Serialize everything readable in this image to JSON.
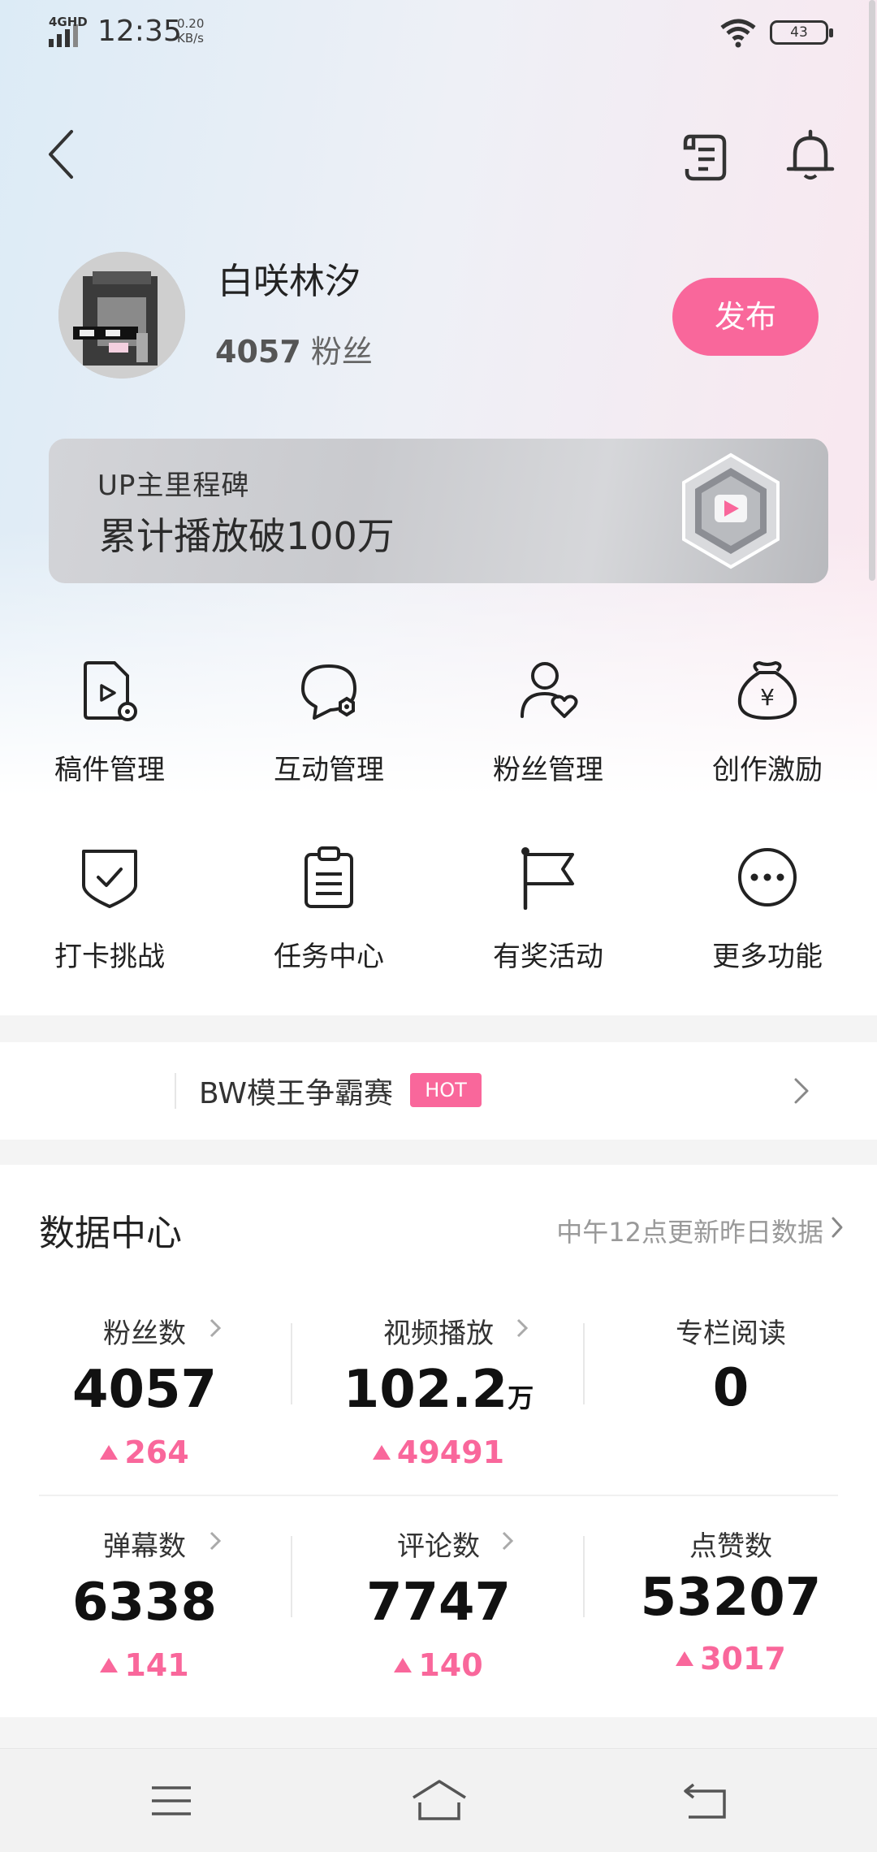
{
  "status_bar": {
    "network": "4GHD",
    "time": "12:35",
    "speed_value": "0.20",
    "speed_unit": "KB/s",
    "battery": "43"
  },
  "header": {
    "back_icon": "chevron-left-icon",
    "doc_icon": "receipt-icon",
    "bell_icon": "bell-icon"
  },
  "profile": {
    "name": "白咲林汐",
    "fans_count": "4057",
    "fans_label": "粉丝",
    "publish_label": "发布"
  },
  "milestone": {
    "title": "UP主里程碑",
    "text": "累计播放破100万"
  },
  "features": [
    {
      "label": "稿件管理",
      "icon": "file-play-icon"
    },
    {
      "label": "互动管理",
      "icon": "chat-bubble-icon"
    },
    {
      "label": "粉丝管理",
      "icon": "user-heart-icon"
    },
    {
      "label": "创作激励",
      "icon": "money-bag-icon"
    },
    {
      "label": "打卡挑战",
      "icon": "shield-check-icon"
    },
    {
      "label": "任务中心",
      "icon": "clipboard-icon"
    },
    {
      "label": "有奖活动",
      "icon": "flag-icon"
    },
    {
      "label": "更多功能",
      "icon": "more-dots-icon"
    }
  ],
  "banner": {
    "text": "BW模王争霸赛",
    "badge": "HOT"
  },
  "data_center": {
    "title": "数据中心",
    "note": "中午12点更新昨日数据",
    "stats": [
      {
        "label": "粉丝数",
        "value": "4057",
        "unit": "",
        "delta": "264",
        "has_arrow": true
      },
      {
        "label": "视频播放",
        "value": "102.2",
        "unit": "万",
        "delta": "49491",
        "has_arrow": true
      },
      {
        "label": "专栏阅读",
        "value": "0",
        "unit": "",
        "delta": "",
        "has_arrow": false
      },
      {
        "label": "弹幕数",
        "value": "6338",
        "unit": "",
        "delta": "141",
        "has_arrow": true
      },
      {
        "label": "评论数",
        "value": "7747",
        "unit": "",
        "delta": "140",
        "has_arrow": true
      },
      {
        "label": "点赞数",
        "value": "53207",
        "unit": "",
        "delta": "3017",
        "has_arrow": false
      }
    ]
  },
  "colors": {
    "accent": "#f9679b",
    "text": "#222222",
    "muted": "#999999"
  }
}
